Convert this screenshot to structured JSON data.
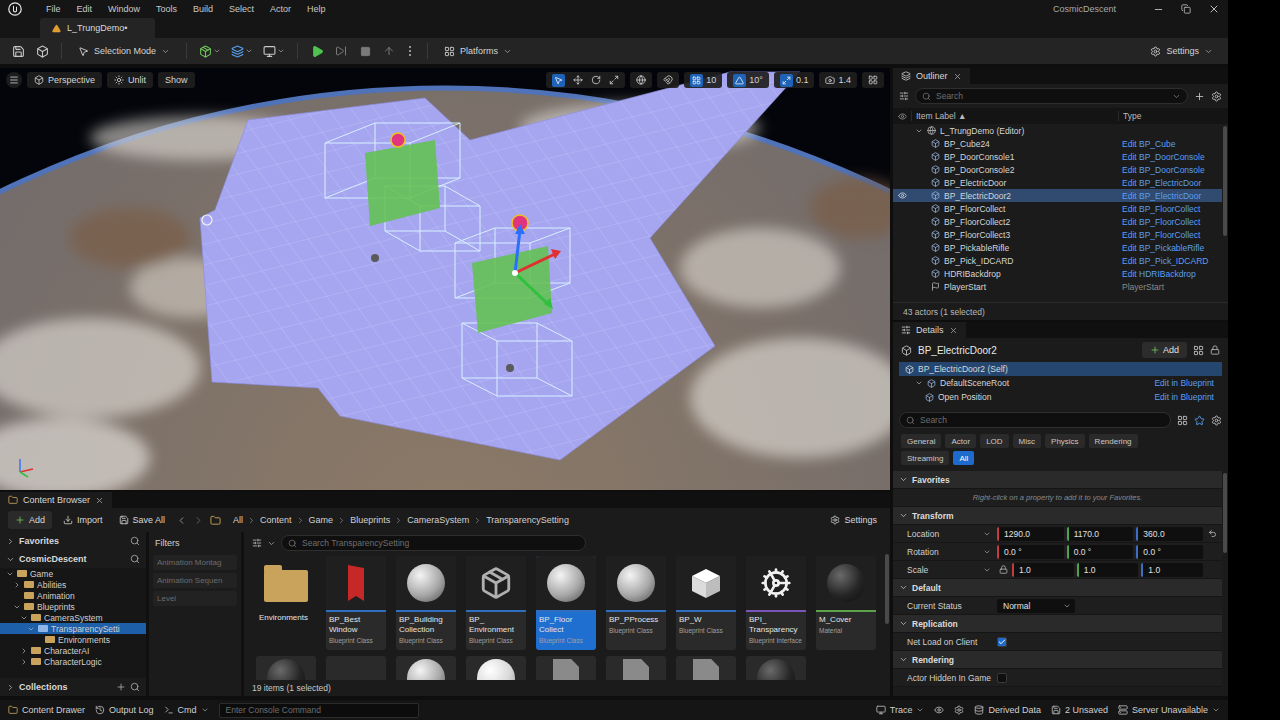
{
  "window": {
    "title": "CosmicDescent",
    "menu": [
      "File",
      "Edit",
      "Window",
      "Tools",
      "Build",
      "Select",
      "Actor",
      "Help"
    ]
  },
  "level_tab": {
    "label": "L_TrungDemo•",
    "selected": true
  },
  "toolbar": {
    "mode": "Selection Mode",
    "platforms": "Platforms",
    "settings": "Settings"
  },
  "viewport": {
    "view": "Perspective",
    "lighting": "Unlit",
    "show": "Show",
    "snaps": [
      {
        "kind": "grid",
        "value": "10",
        "on": true
      },
      {
        "kind": "angle",
        "value": "10°",
        "on": true
      },
      {
        "kind": "scale",
        "value": "0.1",
        "on": true
      }
    ],
    "camera_speed": "1.4"
  },
  "outliner": {
    "title": "Outliner",
    "search_placeholder": "Search",
    "columns": [
      "Item Label ▲",
      "Type"
    ],
    "rows": [
      {
        "label": "L_TrungDemo (Editor)",
        "type": "",
        "kind": "level",
        "selected": false,
        "eye": false
      },
      {
        "label": "BP_Cube24",
        "type": "Edit BP_Cube",
        "kind": "actor",
        "selected": false,
        "eye": false
      },
      {
        "label": "BP_DoorConsole1",
        "type": "Edit BP_DoorConsole",
        "kind": "actor",
        "selected": false,
        "eye": false
      },
      {
        "label": "BP_DoorConsole2",
        "type": "Edit BP_DoorConsole",
        "kind": "actor",
        "selected": false,
        "eye": false
      },
      {
        "label": "BP_ElectricDoor",
        "type": "Edit BP_ElectricDoor",
        "kind": "actor",
        "selected": false,
        "eye": false
      },
      {
        "label": "BP_ElectricDoor2",
        "type": "Edit BP_ElectricDoor",
        "kind": "actor",
        "selected": true,
        "eye": true
      },
      {
        "label": "BP_FloorCollect",
        "type": "Edit BP_FloorCollect",
        "kind": "actor",
        "selected": false,
        "eye": false
      },
      {
        "label": "BP_FloorCollect2",
        "type": "Edit BP_FloorCollect",
        "kind": "actor",
        "selected": false,
        "eye": false
      },
      {
        "label": "BP_FloorCollect3",
        "type": "Edit BP_FloorCollect",
        "kind": "actor",
        "selected": false,
        "eye": false
      },
      {
        "label": "BP_PickableRifle",
        "type": "Edit BP_PickableRifle",
        "kind": "actor",
        "selected": false,
        "eye": false
      },
      {
        "label": "BP_Pick_IDCARD",
        "type": "Edit BP_Pick_IDCARD",
        "kind": "actor",
        "selected": false,
        "eye": false
      },
      {
        "label": "HDRIBackdrop",
        "type": "Edit HDRIBackdrop",
        "kind": "actor",
        "selected": false,
        "eye": false
      },
      {
        "label": "PlayerStart",
        "type": "PlayerStart",
        "kind": "start",
        "selected": false,
        "eye": false
      }
    ],
    "footer": "43 actors (1 selected)"
  },
  "details": {
    "title": "Details",
    "actor": "BP_ElectricDoor2",
    "add": "Add",
    "components": [
      {
        "label": "BP_ElectricDoor2 (Self)",
        "action": "",
        "depth": 0,
        "selected": true,
        "has_children": false
      },
      {
        "label": "DefaultSceneRoot",
        "action": "Edit in Blueprint",
        "depth": 1,
        "selected": false,
        "has_children": true
      },
      {
        "label": "Open Position",
        "action": "Edit in Blueprint",
        "depth": 2,
        "selected": false,
        "has_children": false
      }
    ],
    "search_placeholder": "Search",
    "filters": [
      {
        "label": "General",
        "selected": false
      },
      {
        "label": "Actor",
        "selected": false
      },
      {
        "label": "LOD",
        "selected": false
      },
      {
        "label": "Misc",
        "selected": false
      },
      {
        "label": "Physics",
        "selected": false
      },
      {
        "label": "Rendering",
        "selected": false
      },
      {
        "label": "Streaming",
        "selected": false
      },
      {
        "label": "All",
        "selected": true
      }
    ],
    "sections": [
      {
        "title": "Favorites",
        "expanded": true,
        "rows": [
          {
            "kind": "hint",
            "label": "Right-click on a property to add it to your Favorites."
          }
        ]
      },
      {
        "title": "Transform",
        "expanded": true,
        "rows": [
          {
            "kind": "vector",
            "label": "Location",
            "modified": true,
            "lock": false,
            "values": [
              {
                "value": "1290.0",
                "color": "#c43c3c"
              },
              {
                "value": "1170.0",
                "color": "#4ea44e"
              },
              {
                "value": "360.0",
                "color": "#3c6ec4"
              }
            ]
          },
          {
            "kind": "vector",
            "label": "Rotation",
            "modified": false,
            "lock": false,
            "values": [
              {
                "value": "0.0 °",
                "color": "#c43c3c"
              },
              {
                "value": "0.0 °",
                "color": "#4ea44e"
              },
              {
                "value": "0.0 °",
                "color": "#3c6ec4"
              }
            ]
          },
          {
            "kind": "vector",
            "label": "Scale",
            "modified": false,
            "lock": true,
            "values": [
              {
                "value": "1.0",
                "color": "#c43c3c"
              },
              {
                "value": "1.0",
                "color": "#4ea44e"
              },
              {
                "value": "1.0",
                "color": "#3c6ec4"
              }
            ]
          }
        ]
      },
      {
        "title": "Default",
        "expanded": true,
        "rows": [
          {
            "kind": "select",
            "label": "Current Status",
            "value": "Normal"
          }
        ]
      },
      {
        "title": "Replication",
        "expanded": true,
        "rows": [
          {
            "kind": "checkbox",
            "label": "Net Load on Client",
            "checked": true
          }
        ]
      },
      {
        "title": "Rendering",
        "expanded": true,
        "rows": [
          {
            "kind": "checkbox",
            "label": "Actor Hidden In Game",
            "checked": false
          }
        ]
      }
    ]
  },
  "content_browser": {
    "title": "Content Browser",
    "add": "Add",
    "import": "Import",
    "save_all": "Save All",
    "path": [
      "All",
      "Content",
      "Game",
      "Blueprints",
      "CameraSystem",
      "TransparencySetting"
    ],
    "settings": "Settings",
    "favorites": "Favorites",
    "project": "CosmicDescent",
    "tree": [
      {
        "label": "Game",
        "depth": 0,
        "has_children": true,
        "expanded": true,
        "selected": false
      },
      {
        "label": "Abilities",
        "depth": 1,
        "has_children": true,
        "expanded": false,
        "selected": false
      },
      {
        "label": "Animation",
        "depth": 1,
        "has_children": false,
        "expanded": false,
        "selected": false
      },
      {
        "label": "Blueprints",
        "depth": 1,
        "has_children": true,
        "expanded": true,
        "selected": false
      },
      {
        "label": "CameraSystem",
        "depth": 2,
        "has_children": true,
        "expanded": true,
        "selected": false
      },
      {
        "label": "TransparencySetti",
        "depth": 3,
        "has_children": true,
        "expanded": true,
        "selected": true
      },
      {
        "label": "Environments",
        "depth": 4,
        "has_children": false,
        "expanded": false,
        "selected": false
      },
      {
        "label": "CharacterAI",
        "depth": 2,
        "has_children": true,
        "expanded": false,
        "selected": false
      },
      {
        "label": "CharacterLogic",
        "depth": 2,
        "has_children": true,
        "expanded": false,
        "selected": false
      }
    ],
    "collections": "Collections",
    "filters": {
      "title": "Filters",
      "items": [
        "Animation Montag",
        "Animation Sequen",
        "Level"
      ]
    },
    "search_placeholder": "Search TransparencySetting",
    "assets": [
      {
        "name": "Environments",
        "type": "",
        "kind": "folder",
        "color": "#c9a35c",
        "selected": false
      },
      {
        "name": "BP_Best Window",
        "type": "Blueprint Class",
        "kind": "flag",
        "color": "#2f6fc0",
        "selected": false
      },
      {
        "name": "BP_Building Collection",
        "type": "Blueprint Class",
        "kind": "sphere",
        "color": "#2f6fc0",
        "selected": false
      },
      {
        "name": "BP_ Environment",
        "type": "Blueprint Class",
        "kind": "package",
        "color": "#2f6fc0",
        "selected": false
      },
      {
        "name": "BP_Floor Collect",
        "type": "Blueprint Class",
        "kind": "sphere",
        "color": "#2f6fc0",
        "selected": true
      },
      {
        "name": "BP_PProcess",
        "type": "Blueprint Class",
        "kind": "sphere",
        "color": "#2f6fc0",
        "selected": false
      },
      {
        "name": "BP_W",
        "type": "Blueprint Class",
        "kind": "cube",
        "color": "#2f6fc0",
        "selected": false
      },
      {
        "name": "BPI_ Transparency",
        "type": "Blueprint Interface",
        "kind": "gear",
        "color": "#7b54b8",
        "selected": false
      },
      {
        "name": "M_Cover",
        "type": "Material",
        "kind": "material",
        "color": "#5aa34a",
        "selected": false
      }
    ],
    "more_thumbnails": [
      "material",
      "empty",
      "sphere",
      "white",
      "doc",
      "doc",
      "doc",
      "material"
    ],
    "footer": "19 items (1 selected)"
  },
  "status_bar": {
    "content_drawer": "Content Drawer",
    "output_log": "Output Log",
    "cmd": "Cmd",
    "console_placeholder": "Enter Console Command",
    "trace": "Trace",
    "derived_data": "Derived Data",
    "unsaved": "2 Unsaved",
    "server": "Server Unavailable"
  }
}
